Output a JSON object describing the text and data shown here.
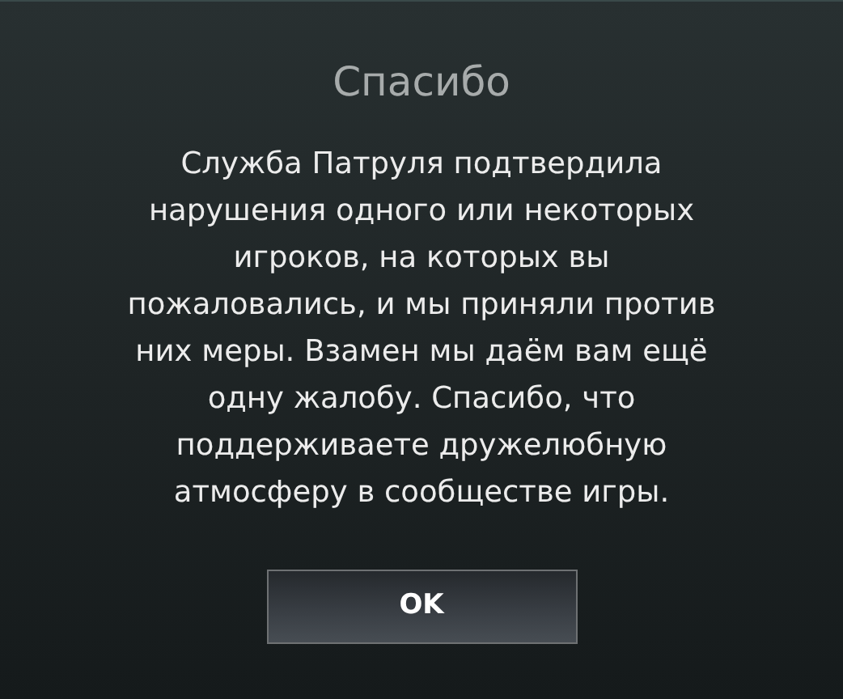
{
  "dialog": {
    "title": "Спасибо",
    "message": "Служба Патруля подтвердила нарушения одного или некоторых игроков, на которых вы пожаловались, и мы приняли против них меры. Взамен мы даём вам ещё одну жалобу. Спасибо, что поддерживаете дружелюбную атмосферу в сообществе игры.",
    "buttons": [
      "OK"
    ]
  }
}
